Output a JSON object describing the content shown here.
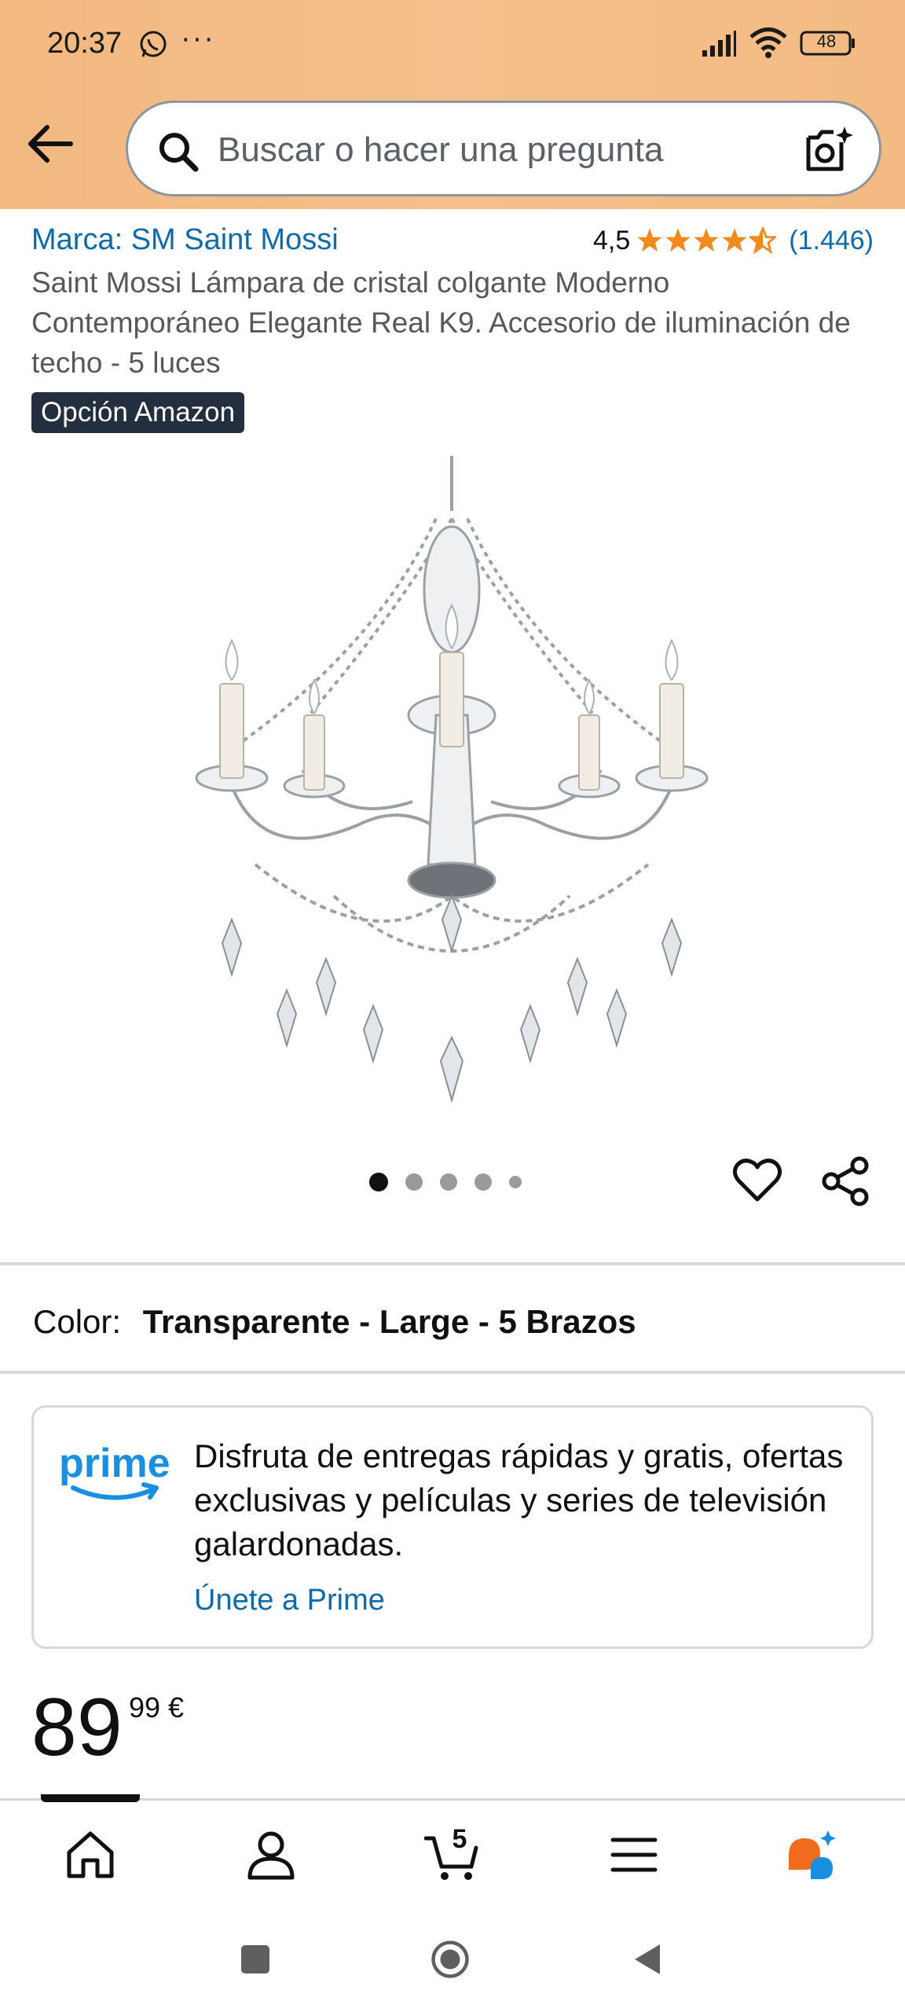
{
  "status_bar": {
    "time": "20:37",
    "more_indicator": "···",
    "battery": "48",
    "icons": [
      "whatsapp-icon",
      "signal-icon",
      "wifi-icon",
      "battery-icon"
    ]
  },
  "header": {
    "search_placeholder": "Buscar o hacer una pregunta",
    "icons": [
      "back-arrow-icon",
      "search-icon",
      "camera-search-icon"
    ]
  },
  "product": {
    "brand": "Marca: SM Saint Mossi",
    "rating": "4,5",
    "rating_value": 4.5,
    "review_count": "(1.446)",
    "title": "Saint Mossi Lámpara de cristal colgante Moderno Contemporáneo Elegante Real K9. Accesorio de iluminación de techo - 5 luces",
    "badge": "Opción Amazon",
    "image_count": 5,
    "active_image": 1
  },
  "variation": {
    "label": "Color:",
    "value": "Transparente - Large - 5 Brazos"
  },
  "prime": {
    "logo_text": "prime",
    "description": "Disfruta de entregas rápidas y gratis, ofertas exclusivas y películas y series de televisión galardonadas.",
    "link": "Únete a Prime"
  },
  "price": {
    "whole": "89",
    "fraction": "99 €"
  },
  "bottom_nav": {
    "items": [
      "home-icon",
      "account-icon",
      "cart-icon",
      "menu-icon",
      "rufus-assistant-icon"
    ],
    "cart_count": "5"
  },
  "colors": {
    "header_bg": "#f3ba83",
    "link": "#0e6aa8",
    "star": "#f08a1e",
    "badge_bg": "#232f3e",
    "prime_blue": "#1a8fe0"
  }
}
